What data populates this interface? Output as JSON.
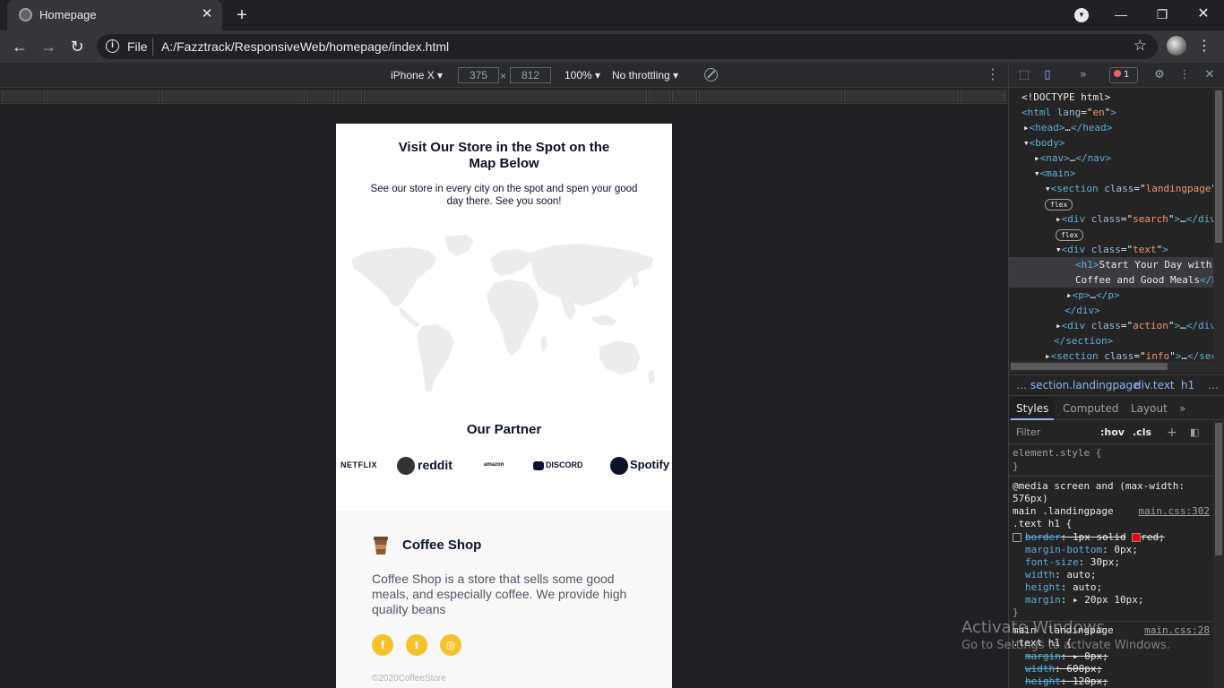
{
  "browser": {
    "tab_title": "Homepage",
    "tab_close": "✕",
    "new_tab": "+",
    "scheme_label": "File",
    "url": "A:/Fazztrack/ResponsiveWeb/homepage/index.html",
    "window_controls": {
      "minimize": "—",
      "maximize": "❐",
      "close": "✕"
    }
  },
  "device_toolbar": {
    "device": "iPhone X",
    "width": "375",
    "height": "812",
    "times": "×",
    "zoom": "100%",
    "throttling": "No throttling"
  },
  "page": {
    "map_title": "Visit Our Store in the Spot on the Map Below",
    "map_desc": "See our store in every city on the spot and spen your good day there. See you soon!",
    "partner_title": "Our Partner",
    "partners": [
      "NETFLIX",
      "reddit",
      "amazon",
      "DISCORD",
      "Spotify"
    ],
    "footer": {
      "brand": "Coffee Shop",
      "about": "Coffee Shop is a store that sells some good meals, and especially coffee. We provide high quality beans",
      "social": [
        "f",
        "t",
        "◎"
      ],
      "copyright": "©2020CoffeeStore"
    },
    "colors": {
      "accent": "#f5c22e",
      "text": "#0b132a",
      "muted": "#4f5665"
    }
  },
  "devtools": {
    "error_count": "1",
    "dom_lines": [
      {
        "indent": 0,
        "html": "<!DOCTYPE html>"
      },
      {
        "indent": 0,
        "tag": "html",
        "attr": "lang",
        "val": "en"
      },
      {
        "indent": 1,
        "collapsed": "head"
      },
      {
        "indent": 1,
        "open": "body"
      },
      {
        "indent": 2,
        "collapsed": "nav"
      },
      {
        "indent": 2,
        "open": "main"
      },
      {
        "indent": 3,
        "open_attr": "section",
        "attr": "class",
        "val": "landingpage"
      },
      {
        "indent": 3,
        "pill": "flex"
      },
      {
        "indent": 4,
        "collapsed_attr": "div",
        "attr": "class",
        "val": "search"
      },
      {
        "indent": 4,
        "pill": "flex"
      },
      {
        "indent": 4,
        "open_attr": "div",
        "attr": "class",
        "val": "text"
      },
      {
        "indent": 5,
        "h1": "Start Your Day with"
      },
      {
        "indent": 5,
        "h1_cont": "Coffee and Good Meals"
      },
      {
        "indent": 5,
        "collapsed": "p"
      },
      {
        "indent": 4,
        "close": "div"
      },
      {
        "indent": 4,
        "collapsed_attr": "div",
        "attr": "class",
        "val": "action"
      },
      {
        "indent": 3,
        "close": "section"
      },
      {
        "indent": 3,
        "collapsed_attr": "section",
        "attr": "class",
        "val": "info"
      }
    ],
    "breadcrumbs": [
      "…",
      "section.landingpage",
      "div.text",
      "h1",
      "…"
    ],
    "tabs": [
      "Styles",
      "Computed",
      "Layout",
      "»"
    ],
    "filter_placeholder": "Filter",
    "hov": ":hov",
    "cls": ".cls",
    "styles": {
      "element_style": "element.style {",
      "close_brace": "}",
      "media": "@media screen and (max-width:",
      "media2": "576px)",
      "selector1": "main .landingpage",
      "selector1b": ".text h1 {",
      "source1": "main.css:302",
      "rules1": [
        {
          "prop": "border",
          "val": "1px solid",
          "extra": "red;",
          "strike": true
        },
        {
          "prop": "margin-bottom",
          "val": "0px;"
        },
        {
          "prop": "font-size",
          "val": "30px;"
        },
        {
          "prop": "width",
          "val": "auto;"
        },
        {
          "prop": "height",
          "val": "auto;"
        },
        {
          "prop": "margin",
          "val": "▸ 20px 10px;"
        }
      ],
      "selector2": "main .landingpage",
      "selector2b": ".text h1 {",
      "source2": "main.css:28",
      "rules2": [
        {
          "prop": "margin",
          "val": "▸ 0px;",
          "strike": true
        },
        {
          "prop": "width",
          "val": "600px;",
          "strike": true
        },
        {
          "prop": "height",
          "val": "120px;",
          "strike": true
        }
      ]
    }
  },
  "watermark": {
    "line1": "Activate Windows",
    "line2": "Go to Settings to activate Windows."
  }
}
